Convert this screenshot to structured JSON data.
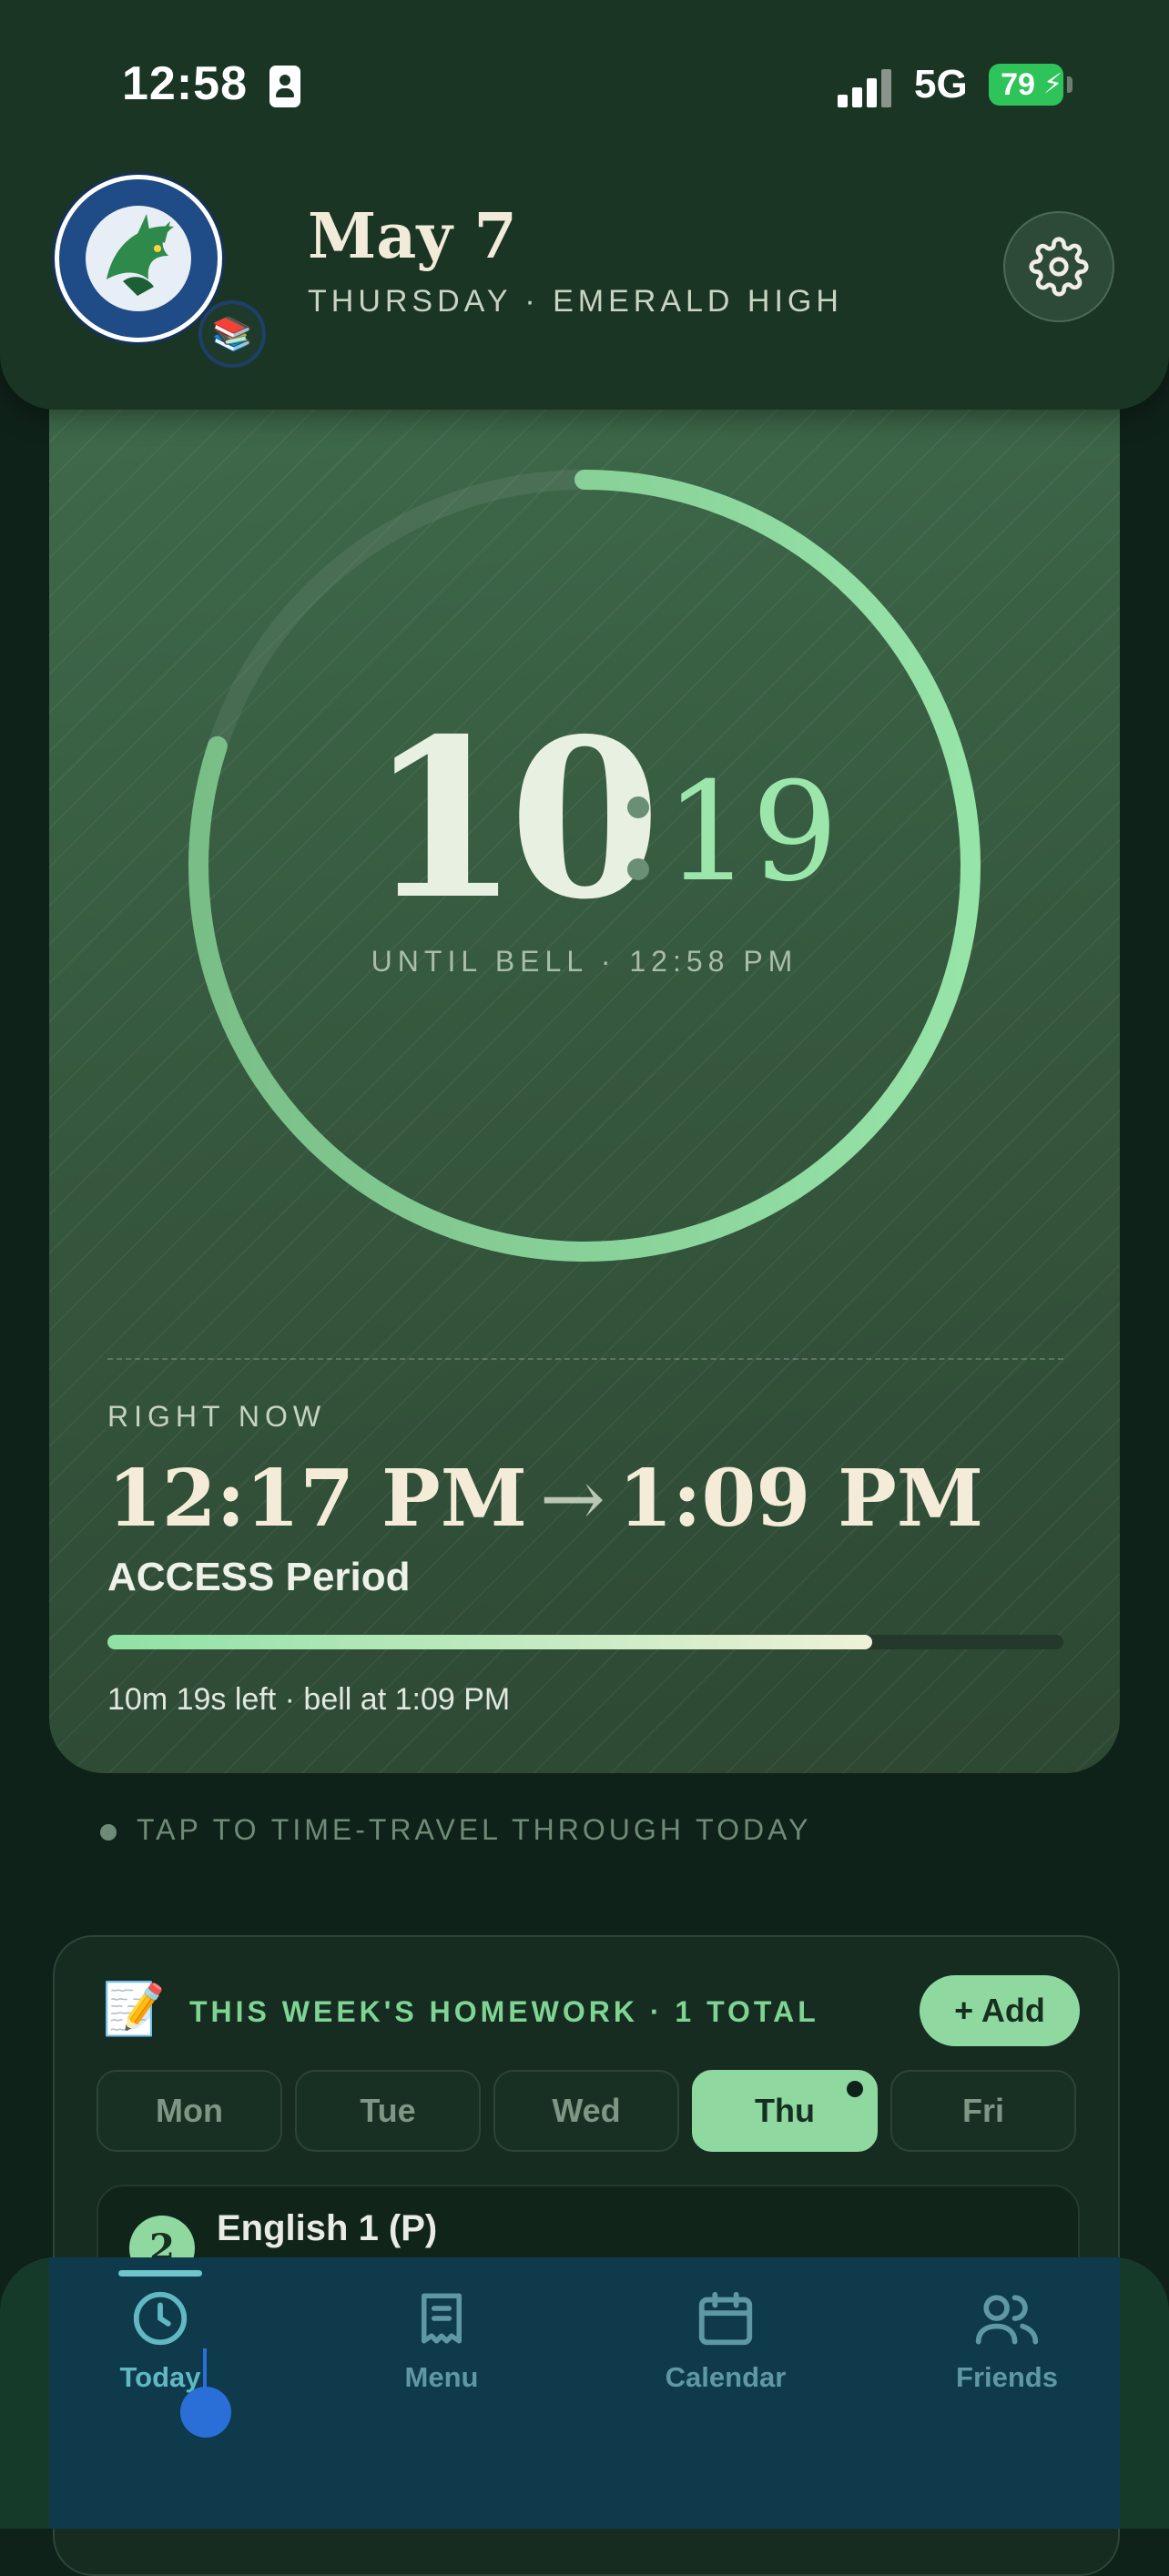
{
  "status_bar": {
    "time": "12:58",
    "network": "5G",
    "battery": "79"
  },
  "header": {
    "date": "May 7",
    "subtitle": "THURSDAY · EMERALD HIGH"
  },
  "timer": {
    "minutes": "10",
    "seconds": "19",
    "until_label": "UNTIL BELL · 12:58 PM",
    "ring_progress": 0.8
  },
  "now": {
    "label": "RIGHT NOW",
    "start": "12:17 PM",
    "end": "1:09 PM",
    "period": "ACCESS Period",
    "progress": 0.8,
    "time_left": "10m 19s left · bell at 1:09 PM"
  },
  "hint": "TAP TO TIME-TRAVEL THROUGH TODAY",
  "homework": {
    "emoji": "📝",
    "title": "THIS WEEK'S HOMEWORK · 1 TOTAL",
    "add_label": "+ Add",
    "days": [
      "Mon",
      "Tue",
      "Wed",
      "Thu",
      "Fri"
    ],
    "active_day": "Thu",
    "first_item": {
      "number": "2",
      "name": "English 1 (P)"
    }
  },
  "nav": {
    "items": [
      {
        "label": "Today",
        "icon": "clock-icon"
      },
      {
        "label": "Menu",
        "icon": "receipt-icon"
      },
      {
        "label": "Calendar",
        "icon": "calendar-icon"
      },
      {
        "label": "Friends",
        "icon": "people-icon"
      }
    ],
    "active": "Today"
  },
  "colors": {
    "accent": "#8fd9a1",
    "header_bg": "#1a3524",
    "card_bg": "#35573d",
    "nav_overlay": "#0e3a4c"
  }
}
